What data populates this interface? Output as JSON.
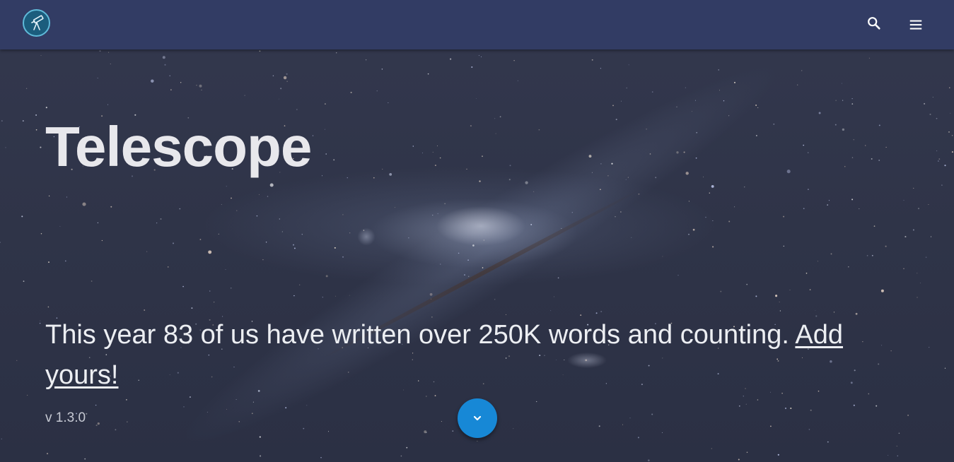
{
  "header": {
    "logo_icon": "telescope-icon",
    "search_icon": "search-icon",
    "menu_icon": "menu-icon",
    "bar_color": "#323c64"
  },
  "hero": {
    "title": "Telescope",
    "tagline_text": "This year 83 of us have written over 250K words and counting. ",
    "tagline_link": "Add yours!",
    "version": "v 1.3.0",
    "scroll_icon": "chevron-down-icon",
    "fab_color": "#1788d6"
  }
}
